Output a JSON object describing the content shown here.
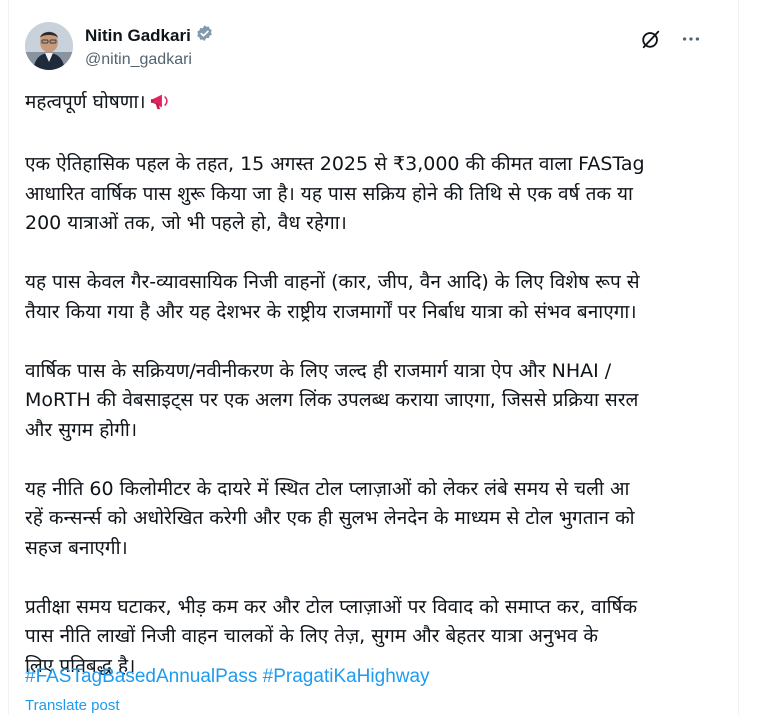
{
  "author": {
    "display_name": "Nitin Gadkari",
    "handle": "@nitin_gadkari",
    "verified_icon": "verified-badge-icon"
  },
  "actions": {
    "grok_icon": "grok-icon",
    "more_icon": "more-options-icon"
  },
  "tweet": {
    "line1": "महत्वपूर्ण घोषणा।",
    "line1_emoji": "megaphone-icon",
    "paragraphs": [
      "एक ऐतिहासिक पहल के तहत, 15 अगस्त 2025 से ₹3,000 की कीमत वाला FASTag\nआधारित वार्षिक पास शुरू किया जा है। यह पास सक्रिय होने की तिथि से एक वर्ष तक या\n200 यात्राओं तक, जो भी पहले हो, वैध रहेगा।",
      "यह पास केवल गैर-व्यावसायिक निजी वाहनों (कार, जीप, वैन आदि) के लिए विशेष रूप से\nतैयार किया गया है और यह देशभर के राष्ट्रीय राजमार्गों पर निर्बाध यात्रा को संभव बनाएगा।",
      "वार्षिक पास के सक्रियण/नवीनीकरण के लिए जल्द ही राजमार्ग यात्रा ऐप और NHAI /\nMoRTH की वेबसाइट्स पर एक अलग लिंक उपलब्ध कराया जाएगा, जिससे प्रक्रिया सरल\nऔर सुगम होगी।",
      "यह नीति 60 किलोमीटर के दायरे में स्थित टोल प्लाज़ाओं को लेकर लंबे समय से चली आ\nरहें कन्सर्न्स को अधोरेखित करेगी और एक ही सुलभ लेनदेन के माध्यम से टोल भुगतान को\nसहज बनाएगी।",
      "प्रतीक्षा समय घटाकर, भीड़ कम कर और टोल प्लाज़ाओं पर विवाद को समाप्त कर, वार्षिक\nपास नीति लाखों निजी वाहन चालकों के लिए तेज़, सुगम और बेहतर यात्रा अनुभव के\nलिए प्रतिबद्ध है।"
    ],
    "hashtag1": "#FASTagBasedAnnualPass",
    "hashtag2": "#PragatiKaHighway",
    "translate_label": "Translate post"
  },
  "colors": {
    "link": "#1d9bf0",
    "verified": "#829aab",
    "text": "#0f1419",
    "secondary": "#536471"
  }
}
